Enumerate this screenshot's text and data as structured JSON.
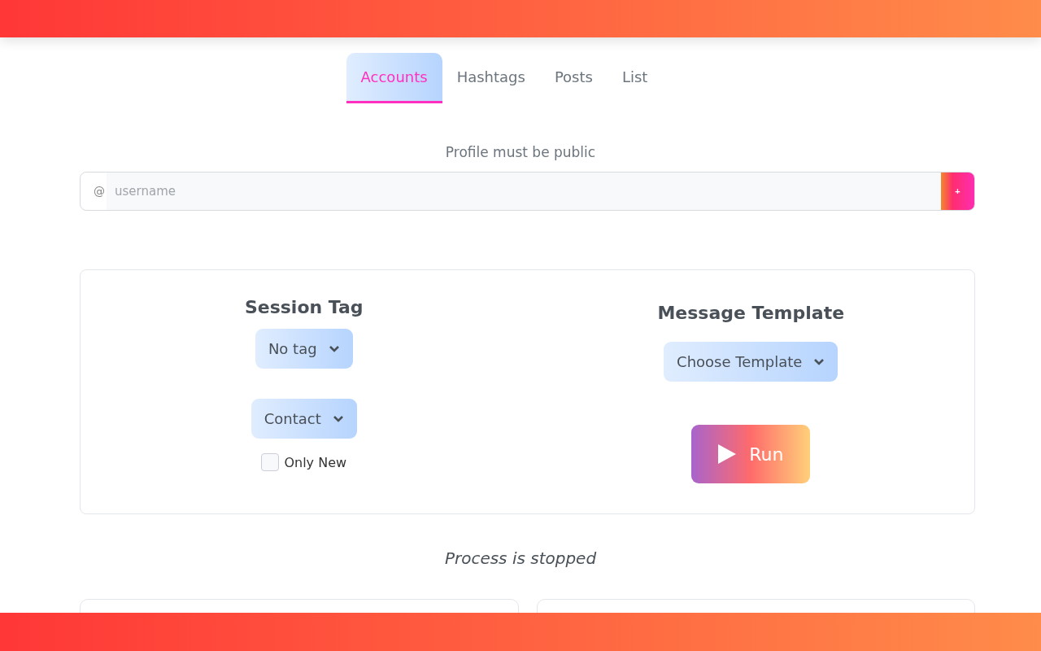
{
  "tabs": [
    {
      "label": "Accounts",
      "selected": true
    },
    {
      "label": "Hashtags",
      "selected": false
    },
    {
      "label": "Posts",
      "selected": false
    },
    {
      "label": "List",
      "selected": false
    }
  ],
  "hint": "Profile must be public",
  "username_field": {
    "prefix": "@",
    "placeholder": "username",
    "add_button": "+"
  },
  "session_tag": {
    "title": "Session Tag",
    "tag_dropdown": "No tag",
    "type_dropdown": "Contact",
    "only_new": {
      "label": "Only New",
      "checked": false
    }
  },
  "message_template": {
    "title": "Message Template",
    "dropdown": "Choose Template",
    "run_button": "Run"
  },
  "status": "Process is stopped"
}
